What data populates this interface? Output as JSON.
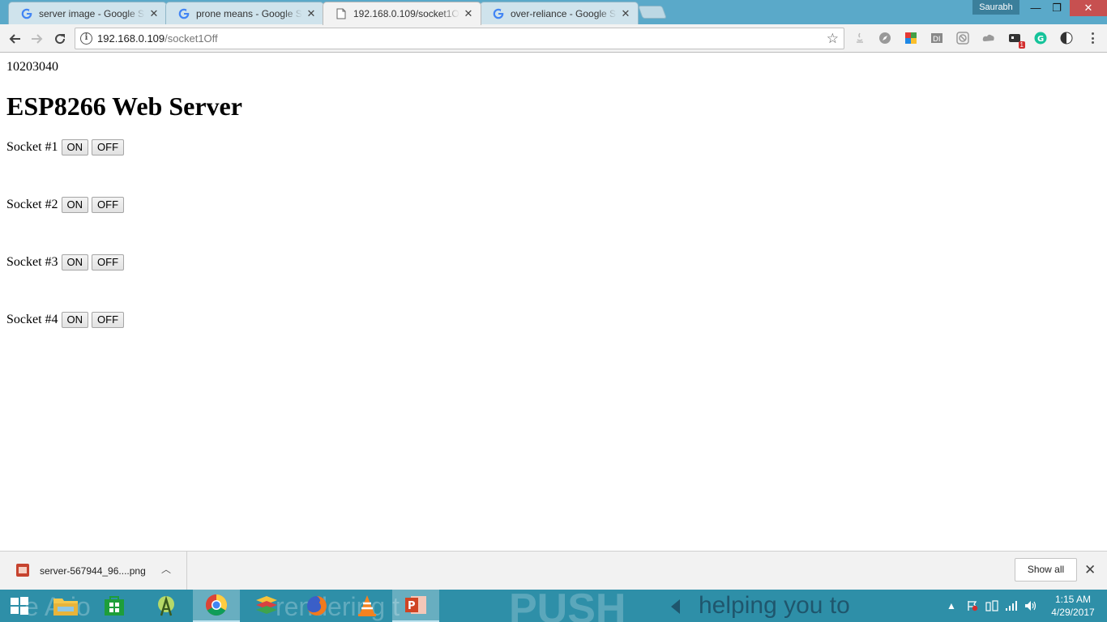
{
  "browser": {
    "tabs": [
      {
        "label": "server image - Google Se",
        "icon": "google-g-icon",
        "active": false
      },
      {
        "label": "prone means - Google Se",
        "icon": "google-g-icon",
        "active": false
      },
      {
        "label": "192.168.0.109/socket1Off",
        "icon": "page-icon",
        "active": true
      },
      {
        "label": "over-reliance - Google Se",
        "icon": "google-g-icon",
        "active": false
      }
    ],
    "profile_name": "Saurabh",
    "url_host": "192.168.0.109",
    "url_path": "/socket1Off",
    "extension_badge": "1"
  },
  "page": {
    "counter_text": "10203040",
    "title": "ESP8266 Web Server",
    "sockets": [
      {
        "label": "Socket #1",
        "on_label": "ON",
        "off_label": "OFF"
      },
      {
        "label": "Socket #2",
        "on_label": "ON",
        "off_label": "OFF"
      },
      {
        "label": "Socket #3",
        "on_label": "ON",
        "off_label": "OFF"
      },
      {
        "label": "Socket #4",
        "on_label": "ON",
        "off_label": "OFF"
      }
    ]
  },
  "download_shelf": {
    "file_name": "server-567944_96....png",
    "show_all_label": "Show all"
  },
  "taskbar": {
    "time": "1:15 AM",
    "date": "4/29/2017",
    "wallpaper_text": [
      "e Ario",
      "rendering t",
      "PUSH",
      "helping you to"
    ]
  },
  "colors": {
    "tab_strip": "#5aa9c9",
    "taskbar": "#2e8fa8",
    "close_button": "#c75050"
  }
}
